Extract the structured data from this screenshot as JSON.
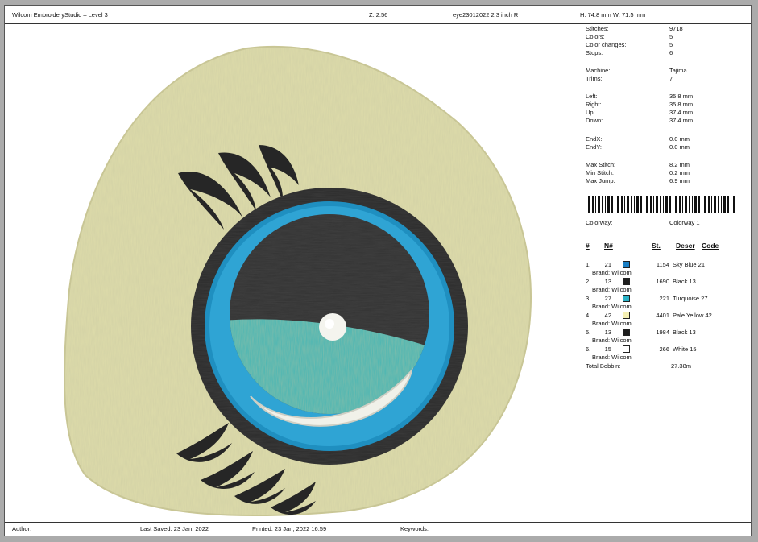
{
  "header": {
    "app_title": "Wilcom EmbroideryStudio – Level 3",
    "zoom": "Z: 2.56",
    "design_name": "eye23012022 2  3 inch R",
    "dimensions": "H: 74.8 mm   W: 71.5 mm"
  },
  "stats": [
    {
      "label": "Stitches:",
      "value": "9718"
    },
    {
      "label": "Colors:",
      "value": "5"
    },
    {
      "label": "Color changes:",
      "value": "5"
    },
    {
      "label": "Stops:",
      "value": "6"
    },
    {
      "label": "Machine:",
      "value": "Tajima"
    },
    {
      "label": "Trims:",
      "value": "7"
    },
    {
      "label": "Left:",
      "value": "35.8 mm"
    },
    {
      "label": "Right:",
      "value": "35.8 mm"
    },
    {
      "label": "Up:",
      "value": "37.4 mm"
    },
    {
      "label": "Down:",
      "value": "37.4 mm"
    },
    {
      "label": "EndX:",
      "value": "0.0 mm"
    },
    {
      "label": "EndY:",
      "value": "0.0 mm"
    },
    {
      "label": "Max Stitch:",
      "value": "8.2 mm"
    },
    {
      "label": "Min Stitch:",
      "value": "0.2 mm"
    },
    {
      "label": "Max Jump:",
      "value": "6.9 mm"
    }
  ],
  "colorway": {
    "label": "Colorway:",
    "value": "Colorway 1"
  },
  "table_headers": {
    "num": "#",
    "n": "N#",
    "st": "St.",
    "descr": "Descr",
    "code": "Code"
  },
  "threads": [
    {
      "index": "1.",
      "n": "21",
      "color": "#1b7fc4",
      "stitches": "1154",
      "descr": "Sky Blue 21",
      "brand": "Brand: Wilcom"
    },
    {
      "index": "2.",
      "n": "13",
      "color": "#1e1e1e",
      "stitches": "1690",
      "descr": "Black 13",
      "brand": "Brand: Wilcom"
    },
    {
      "index": "3.",
      "n": "27",
      "color": "#2bb3c7",
      "stitches": "221",
      "descr": "Turquoise 27",
      "brand": "Brand: Wilcom"
    },
    {
      "index": "4.",
      "n": "42",
      "color": "#f5f0b4",
      "stitches": "4401",
      "descr": "Pale Yellow 42",
      "brand": "Brand: Wilcom"
    },
    {
      "index": "5.",
      "n": "13",
      "color": "#1e1e1e",
      "stitches": "1984",
      "descr": "Black 13",
      "brand": "Brand: Wilcom"
    },
    {
      "index": "6.",
      "n": "15",
      "color": "#ffffff",
      "stitches": "266",
      "descr": "White 15",
      "brand": "Brand: Wilcom"
    }
  ],
  "total_bobbin": {
    "label": "Total Bobbin:",
    "value": "27.38m"
  },
  "footer": {
    "author": "Author:",
    "last_saved": "Last Saved: 23 Jan, 2022",
    "printed": "Printed:  23 Jan, 2022 16:59",
    "keywords": "Keywords:"
  }
}
